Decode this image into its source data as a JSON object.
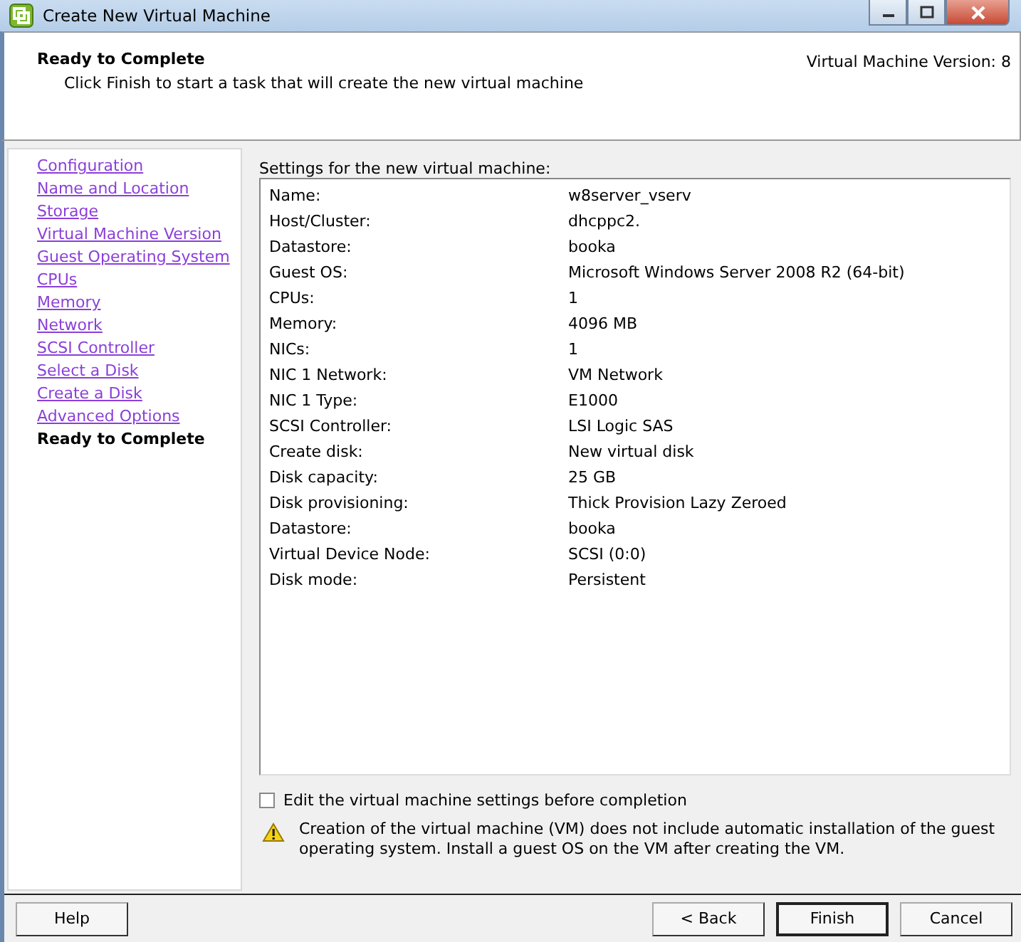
{
  "window": {
    "title": "Create New Virtual Machine"
  },
  "header": {
    "title": "Ready to Complete",
    "subtitle": "Click Finish to start a task that will create the new virtual machine",
    "version": "Virtual Machine Version: 8"
  },
  "steps": [
    {
      "label": "Configuration",
      "selected": false
    },
    {
      "label": "Name and Location",
      "selected": false
    },
    {
      "label": "Storage",
      "selected": false
    },
    {
      "label": "Virtual Machine Version",
      "selected": false
    },
    {
      "label": "Guest Operating System",
      "selected": false
    },
    {
      "label": "CPUs",
      "selected": false
    },
    {
      "label": "Memory",
      "selected": false
    },
    {
      "label": "Network",
      "selected": false
    },
    {
      "label": "SCSI Controller",
      "selected": false
    },
    {
      "label": "Select a Disk",
      "selected": false
    },
    {
      "label": "Create a Disk",
      "selected": false
    },
    {
      "label": "Advanced Options",
      "selected": false
    },
    {
      "label": "Ready to Complete",
      "selected": true
    }
  ],
  "settings": {
    "title": "Settings for the new virtual machine:",
    "rows": [
      {
        "label": "Name:",
        "value": "w8server_vserv"
      },
      {
        "label": "Host/Cluster:",
        "value": "dhcppc2."
      },
      {
        "label": "Datastore:",
        "value": "booka"
      },
      {
        "label": "Guest OS:",
        "value": "Microsoft Windows Server 2008 R2 (64-bit)"
      },
      {
        "label": "CPUs:",
        "value": "1"
      },
      {
        "label": "Memory:",
        "value": "4096 MB"
      },
      {
        "label": "NICs:",
        "value": "1"
      },
      {
        "label": "NIC 1 Network:",
        "value": "VM Network"
      },
      {
        "label": "NIC 1 Type:",
        "value": "E1000"
      },
      {
        "label": "SCSI Controller:",
        "value": "LSI Logic SAS"
      },
      {
        "label": "Create disk:",
        "value": "New virtual disk"
      },
      {
        "label": "Disk capacity:",
        "value": "25 GB"
      },
      {
        "label": "Disk provisioning:",
        "value": "Thick Provision Lazy Zeroed"
      },
      {
        "label": "Datastore:",
        "value": "booka"
      },
      {
        "label": "Virtual Device Node:",
        "value": "SCSI (0:0)"
      },
      {
        "label": "Disk mode:",
        "value": "Persistent"
      }
    ]
  },
  "edit_option": {
    "label": "Edit the virtual machine settings before completion",
    "checked": false
  },
  "warning": "Creation of the virtual machine (VM) does not include automatic installation of the guest operating system. Install a guest OS on the VM after creating the VM.",
  "buttons": {
    "help": "Help",
    "back": "< Back",
    "finish": "Finish",
    "cancel": "Cancel"
  }
}
